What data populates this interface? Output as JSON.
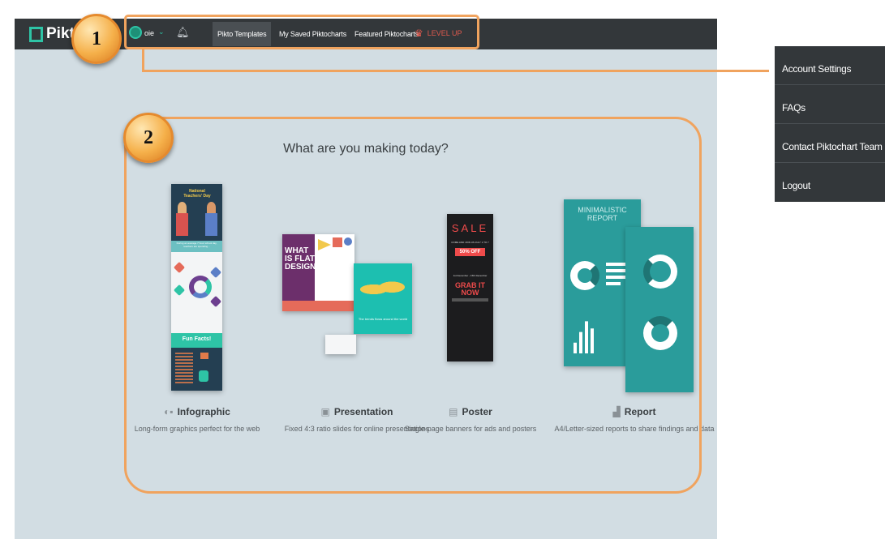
{
  "nav": {
    "logo_text": "Pikt",
    "username": "oie",
    "caret_icon": "chevron-down-icon",
    "bell_icon": "bell-icon",
    "links": [
      "Pikto Templates",
      "My Saved Piktocharts",
      "Featured Piktocharts"
    ],
    "level_up": "LEVEL UP",
    "level_up_color": "#e05a4e"
  },
  "badges": [
    "1",
    "2"
  ],
  "dropdown": {
    "items": [
      "Account Settings",
      "FAQs",
      "Contact Piktochart Team",
      "Logout"
    ]
  },
  "main": {
    "headline": "What are you making today?",
    "options": [
      {
        "icon": "infographic-icon",
        "icon_glyph": "◐▪",
        "title": "Infographic",
        "desc": "Long-form graphics perfect for the web"
      },
      {
        "icon": "presentation-icon",
        "icon_glyph": "▣",
        "title": "Presentation",
        "desc": "Fixed 4:3 ratio slides for online presentations"
      },
      {
        "icon": "poster-icon",
        "icon_glyph": "▤",
        "title": "Poster",
        "desc": "Single-page banners for ads and posters"
      },
      {
        "icon": "report-icon",
        "icon_glyph": "▟",
        "title": "Report",
        "desc": "A4/Letter-sized reports to share findings and data"
      }
    ],
    "thumbs": {
      "infographic": {
        "title": "National Teachers' Day",
        "subtitle": "During an average 7 hour school day, teachers are spending...",
        "fun_facts": "Fun Facts!"
      },
      "presentation": {
        "title": "WHAT IS FLAT DESIGN",
        "caption": "The trends flows around the world"
      },
      "poster": {
        "sale": "SALE",
        "line1": "COME AND JOIN US JULY 1 TO 7",
        "discount": "50% OFF",
        "line2": "1st December - 15th December",
        "grab": "GRAB IT NOW"
      },
      "report": {
        "title": "MINIMALISTIC REPORT"
      }
    }
  },
  "colors": {
    "accent": "#2ec4a6",
    "annotation": "#f0a35e",
    "nav_bg": "#33373a",
    "page_bg": "#d2dde3"
  }
}
